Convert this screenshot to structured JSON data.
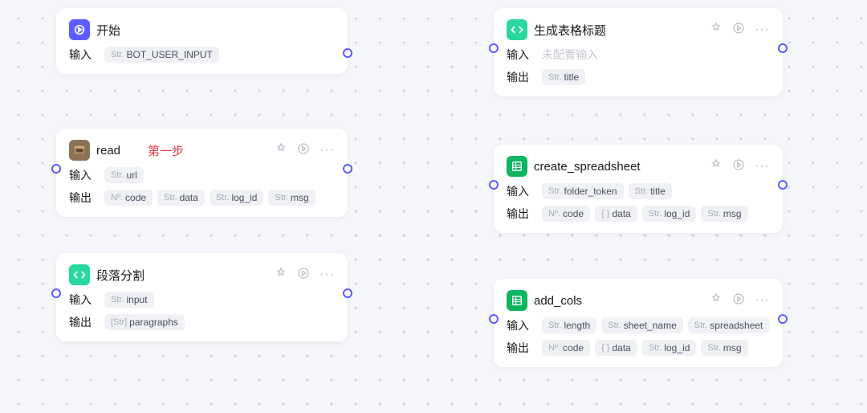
{
  "labels": {
    "input": "输入",
    "output": "输出"
  },
  "types": {
    "str": "Str.",
    "num": "Nº.",
    "obj": "{ }",
    "arr": "[Str]"
  },
  "annotation": "第一步",
  "nodes": {
    "start": {
      "title": "开始",
      "inputs": [
        {
          "t": "str",
          "n": "BOT_USER_INPUT"
        }
      ]
    },
    "read": {
      "title": "read",
      "inputs": [
        {
          "t": "str",
          "n": "url"
        }
      ],
      "outputs": [
        {
          "t": "num",
          "n": "code"
        },
        {
          "t": "str",
          "n": "data"
        },
        {
          "t": "str",
          "n": "log_id"
        },
        {
          "t": "str",
          "n": "msg"
        }
      ]
    },
    "segment": {
      "title": "段落分割",
      "inputs": [
        {
          "t": "str",
          "n": "input"
        }
      ],
      "outputs": [
        {
          "t": "arr",
          "n": "paragraphs"
        }
      ]
    },
    "genTitle": {
      "title": "生成表格标题",
      "inputPlaceholder": "未配置输入",
      "outputs": [
        {
          "t": "str",
          "n": "title"
        }
      ]
    },
    "createSheet": {
      "title": "create_spreadsheet",
      "inputs": [
        {
          "t": "str",
          "n": "folder_token"
        },
        {
          "t": "str",
          "n": "title"
        }
      ],
      "outputs": [
        {
          "t": "num",
          "n": "code"
        },
        {
          "t": "obj",
          "n": "data"
        },
        {
          "t": "str",
          "n": "log_id"
        },
        {
          "t": "str",
          "n": "msg"
        }
      ]
    },
    "addCols": {
      "title": "add_cols",
      "inputs": [
        {
          "t": "str",
          "n": "length"
        },
        {
          "t": "str",
          "n": "sheet_name"
        },
        {
          "t": "str",
          "n": "spreadsheet"
        }
      ],
      "outputs": [
        {
          "t": "num",
          "n": "code"
        },
        {
          "t": "obj",
          "n": "data"
        },
        {
          "t": "str",
          "n": "log_id"
        },
        {
          "t": "str",
          "n": "msg"
        }
      ]
    }
  }
}
